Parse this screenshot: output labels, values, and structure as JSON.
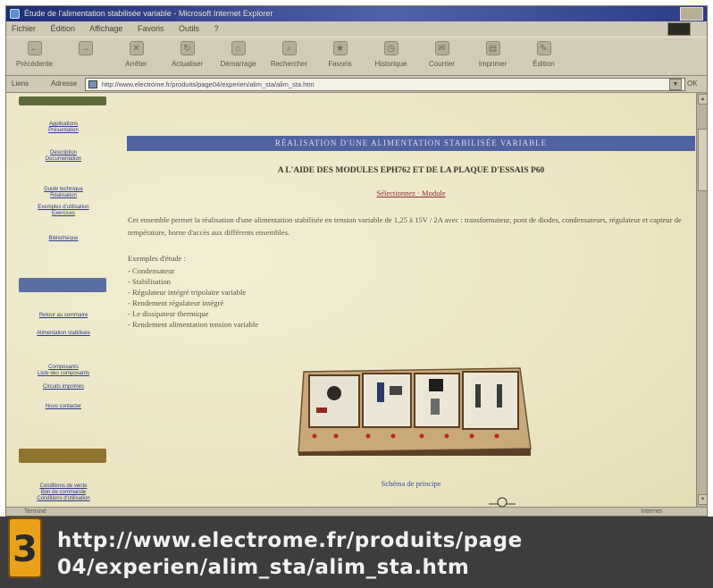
{
  "window": {
    "title": "Étude de l'alimentation stabilisée variable - Microsoft Internet Explorer"
  },
  "menu": [
    "Fichier",
    "Édition",
    "Affichage",
    "Favoris",
    "Outils",
    "?"
  ],
  "toolbar": [
    {
      "label": "Précédente",
      "icon": "back-arrow-icon"
    },
    {
      "label": "",
      "icon": "forward-arrow-icon"
    },
    {
      "label": "Arrêter",
      "icon": "stop-icon"
    },
    {
      "label": "Actualiser",
      "icon": "refresh-icon"
    },
    {
      "label": "Démarrage",
      "icon": "home-icon"
    },
    {
      "label": "Rechercher",
      "icon": "search-icon"
    },
    {
      "label": "Favoris",
      "icon": "favorites-icon"
    },
    {
      "label": "Historique",
      "icon": "history-icon"
    },
    {
      "label": "Courrier",
      "icon": "mail-icon"
    },
    {
      "label": "Imprimer",
      "icon": "print-icon"
    },
    {
      "label": "Édition",
      "icon": "edit-icon"
    }
  ],
  "address": {
    "label": "Liens",
    "label2": "Adresse",
    "url": "http://www.electrome.fr/produits/page04/experien/alim_sta/alim_sta.htm",
    "go": "OK"
  },
  "sidebar": {
    "links_top": [
      "Applications",
      "Présentation",
      "Description",
      "Documentation",
      "Guide technique",
      "Réalisation",
      "Exemples d'utilisation",
      "Exercices",
      "Bibliothèque"
    ],
    "links_mid": [
      "Retour au sommaire",
      "Alimentation stabilisée",
      "Composants",
      "Liste des composants",
      "Circuits imprimés",
      "Nous contacter"
    ],
    "links_bottom": [
      "Conditions de vente",
      "Bon de commande",
      "Conditions d'utilisation"
    ]
  },
  "page": {
    "banner": "RÉALISATION D'UNE ALIMENTATION STABILISÉE VARIABLE",
    "subtitle": "A L'AIDE DES MODULES EPH762 ET DE LA PLAQUE D'ESSAIS P60",
    "subtitle2": "Sélectionnez · Module",
    "paragraph": "Cet ensemble permet la réalisation d'une alimentation stabilisée en tension variable de 1,25 à 15V / 2A avec : transformateur, pont de diodes, condensateurs, régulateur et capteur de température, borne d'accès aux différents ensembles.",
    "examples_title": "Exemples d'étude :",
    "examples": [
      "- Condensateur",
      "- Stabilisation",
      "- Régulateur intégré tripolaire variable",
      "- Rendement régulateur intégré",
      "- Le dissipateur thermique",
      "- Rendement alimentation tension variable"
    ],
    "caption": "Schéma de principe"
  },
  "status": {
    "text": "Terminé",
    "zone": "Internet"
  },
  "overlay": {
    "badge_number": "3",
    "line1": "http://www.electrome.fr/produits/page",
    "line2": "04/experien/alim_sta/alim_sta.htm"
  },
  "colors": {
    "banner": "#4f63a0",
    "link": "#2e3a8a",
    "overlay_bg": "#3d3d3d",
    "badge": "#e8a21a"
  }
}
